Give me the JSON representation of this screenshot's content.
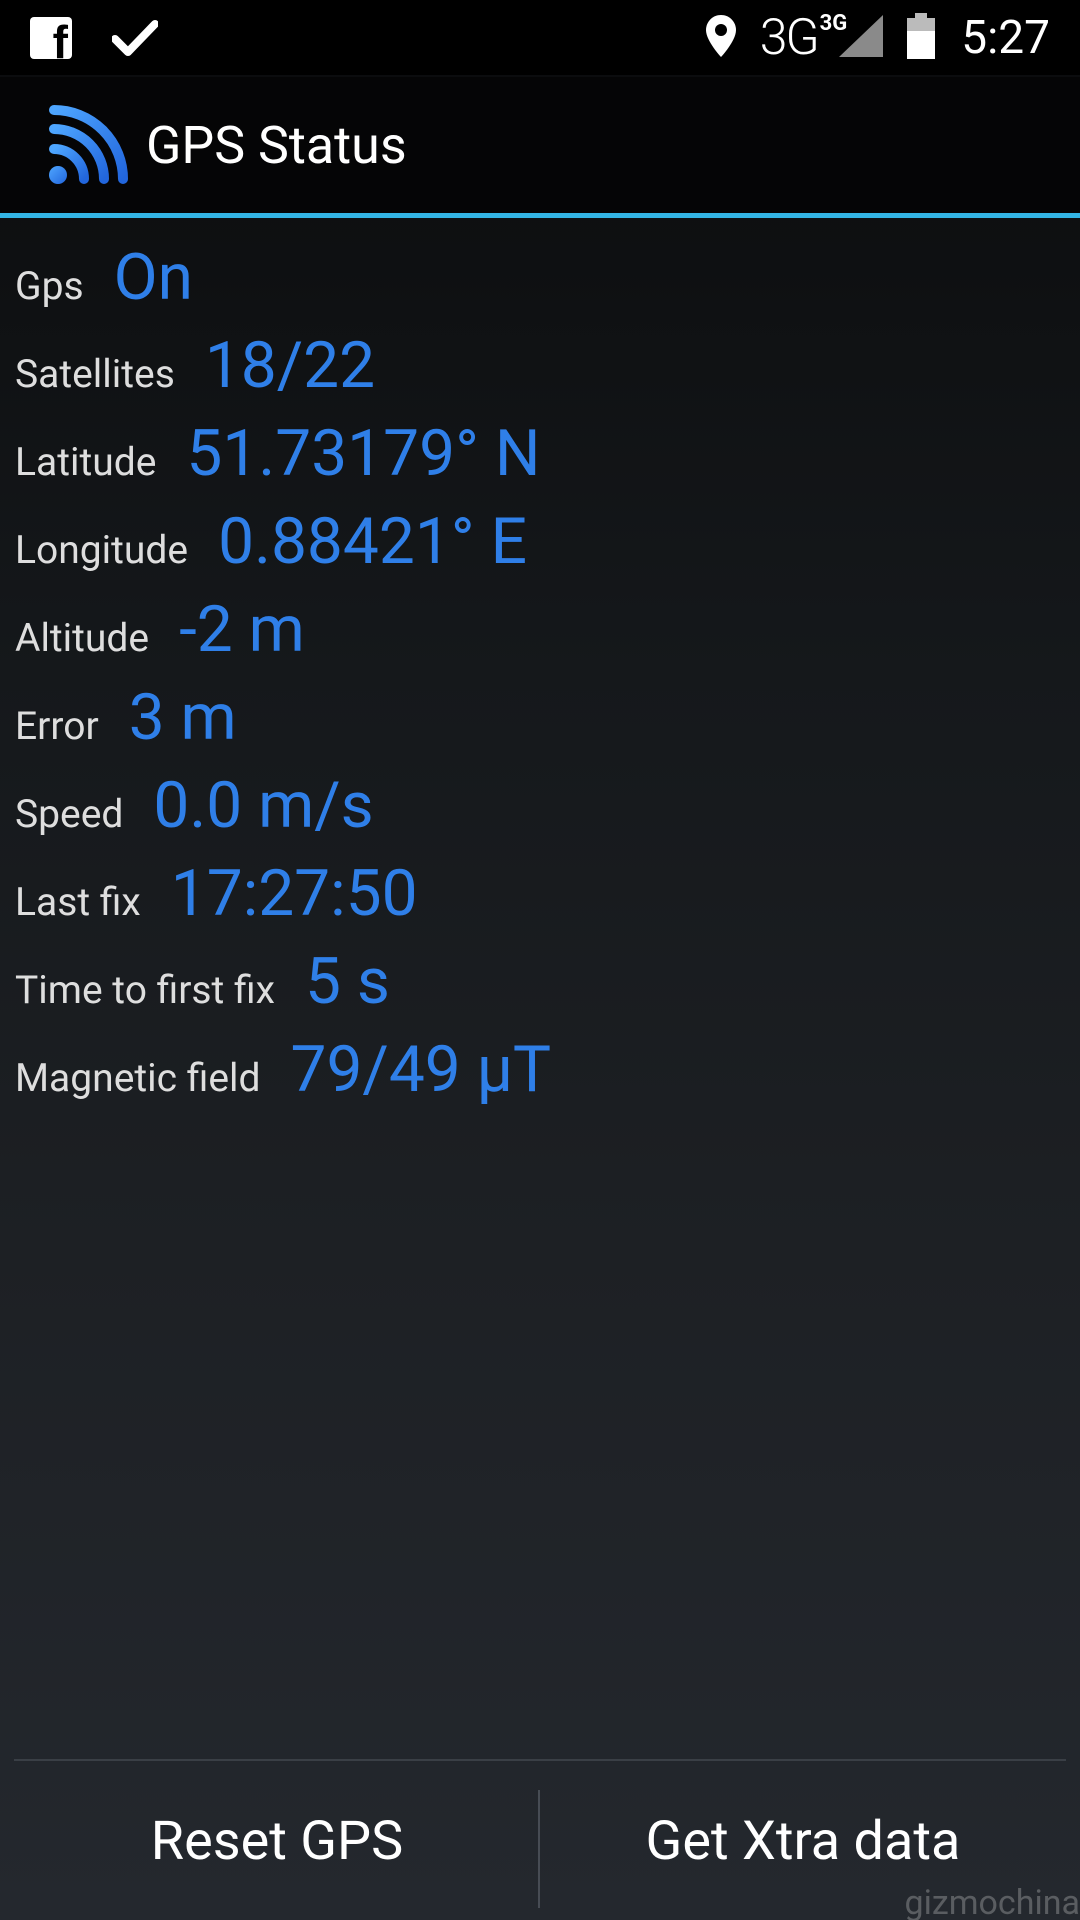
{
  "status_bar": {
    "notification_icons": [
      "facebook-icon",
      "check-icon"
    ],
    "network_type": "3G",
    "network_superscript": "3G",
    "time": "5:27"
  },
  "action_bar": {
    "title": "GPS Status",
    "icon": "gps-signal-icon",
    "accent_color": "#33b5e5"
  },
  "gps_info": [
    {
      "label": "Gps",
      "value": "On"
    },
    {
      "label": "Satellites",
      "value": "18/22"
    },
    {
      "label": "Latitude",
      "value": "51.73179° N"
    },
    {
      "label": "Longitude",
      "value": "0.88421° E"
    },
    {
      "label": "Altitude",
      "value": "-2 m"
    },
    {
      "label": "Error",
      "value": "3 m"
    },
    {
      "label": "Speed",
      "value": "0.0 m/s"
    },
    {
      "label": "Last fix",
      "value": "17:27:50"
    },
    {
      "label": "Time to first fix",
      "value": "5 s"
    },
    {
      "label": "Magnetic field",
      "value": "79/49 µT"
    }
  ],
  "colors": {
    "value_color": "#2f7fe8",
    "label_color": "#dedede"
  },
  "buttons": {
    "reset_gps": "Reset GPS",
    "get_xtra": "Get Xtra data"
  },
  "watermark": "gizmochina"
}
